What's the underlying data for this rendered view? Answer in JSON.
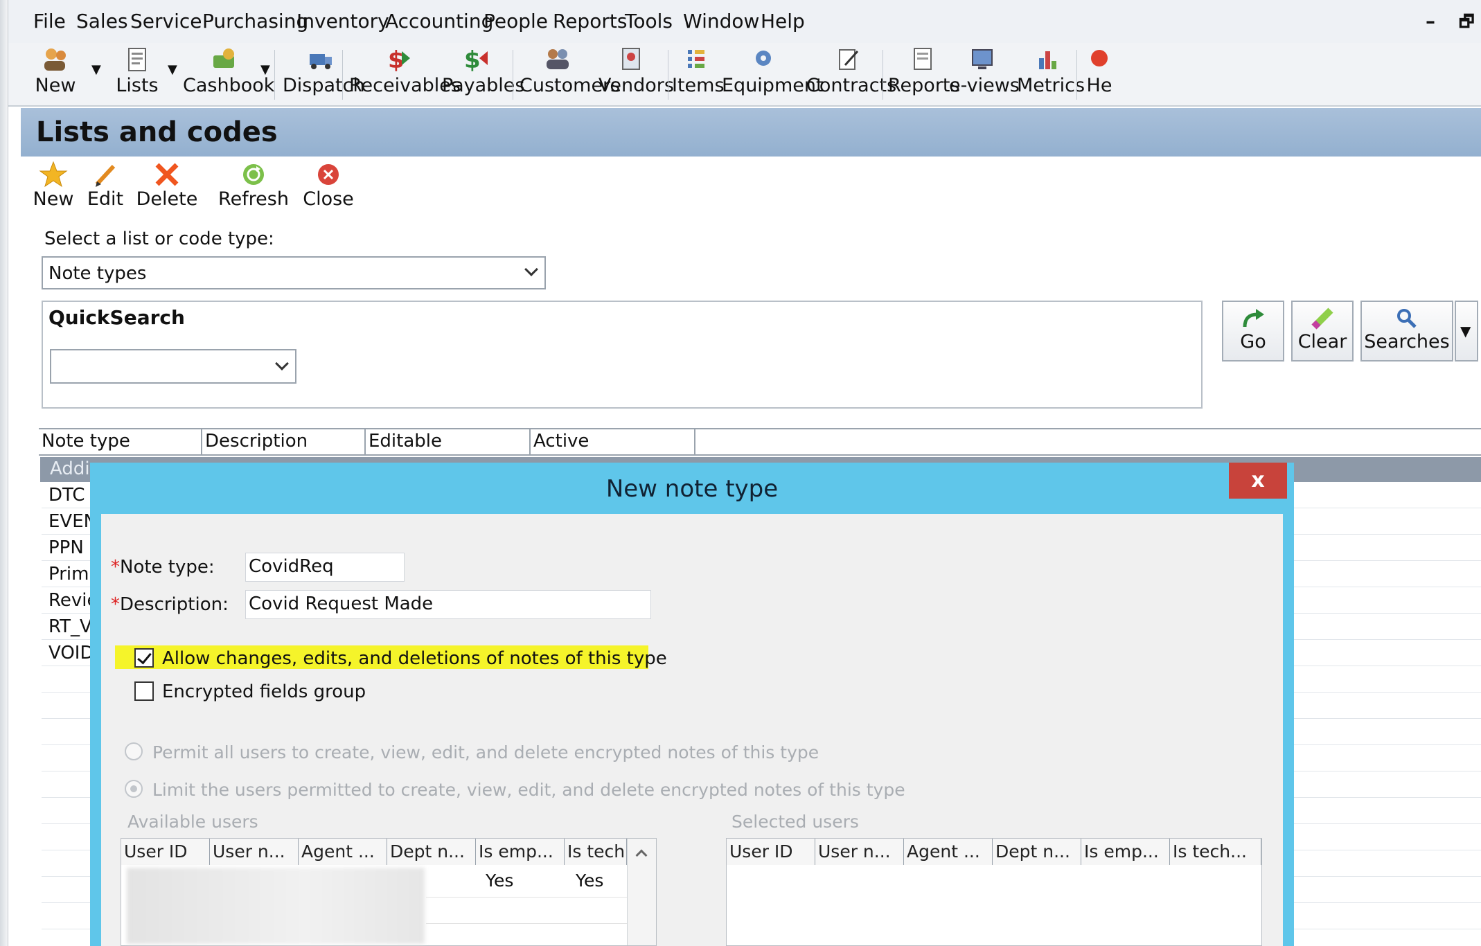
{
  "menu": [
    "File",
    "Sales",
    "Service",
    "Purchasing",
    "Inventory",
    "Accounting",
    "People",
    "Reports",
    "Tools",
    "Window",
    "Help"
  ],
  "window_controls": {
    "minimize": "–",
    "restore": "🗗"
  },
  "toolbar": {
    "new": "New",
    "lists": "Lists",
    "cashbook": "Cashbook",
    "dispatch": "Dispatch",
    "receivables": "Receivables",
    "payables": "Payables",
    "customers": "Customers",
    "vendors": "Vendors",
    "items": "Items",
    "equipment": "Equipment",
    "contracts": "Contracts",
    "reports": "Reports",
    "eviews": "e-views",
    "metrics": "Metrics",
    "help": "He"
  },
  "panel": {
    "title": "Lists and codes",
    "actions": {
      "new": "New",
      "edit": "Edit",
      "delete": "Delete",
      "refresh": "Refresh",
      "close": "Close"
    },
    "select_label": "Select a list or code type:",
    "select_value": "Note types"
  },
  "quicksearch": {
    "title": "QuickSearch",
    "value": "",
    "go": "Go",
    "clear": "Clear",
    "searches": "Searches"
  },
  "grid": {
    "columns": [
      "Note type",
      "Description",
      "Editable",
      "Active"
    ],
    "selected_row": "Addi",
    "rows": [
      "DTC",
      "EVEN",
      "PPN",
      "Prima",
      "Revie",
      "RT_V",
      "VOID"
    ]
  },
  "dialog": {
    "title": "New note type",
    "close": "x",
    "note_type_label": "Note type:",
    "note_type_value": "CovidReq",
    "description_label": "Description:",
    "description_value": "Covid Request Made",
    "required_mark": "*",
    "allow_changes_label": "Allow changes, edits, and deletions of notes of this type",
    "allow_changes_checked": true,
    "encrypted_label": "Encrypted fields group",
    "encrypted_checked": false,
    "radio_permit_all": "Permit all users to create, view, edit, and delete encrypted notes of this type",
    "radio_limit": "Limit the users permitted to create, view, edit, and delete encrypted notes of this type",
    "available_users_label": "Available users",
    "selected_users_label": "Selected users",
    "user_columns": [
      "User ID",
      "User n...",
      "Agent ...",
      "Dept n...",
      "Is emp...",
      "Is tech..."
    ],
    "available_first_row": {
      "is_emp": "Yes",
      "is_tech": "Yes"
    }
  },
  "colors": {
    "dialog_frame": "#5fc6ea",
    "close_button": "#c8433b",
    "highlight": "#f5f42a",
    "panel_header": "#a0bad7"
  }
}
